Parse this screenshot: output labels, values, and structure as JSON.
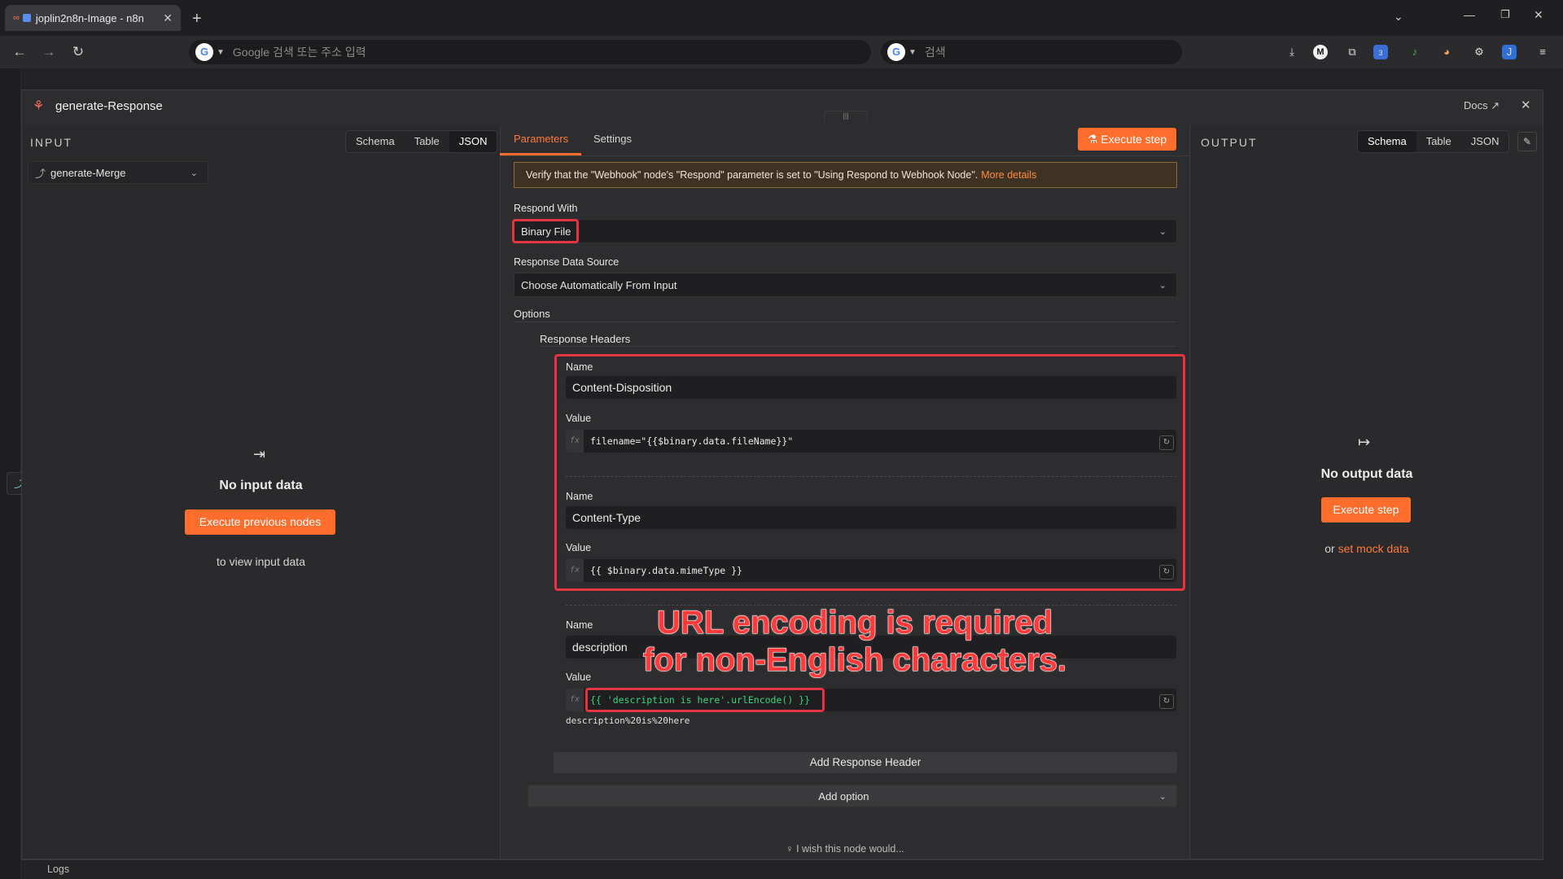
{
  "browser": {
    "tab_title": "joplin2n8n-Image - n8n",
    "address_placeholder": "Google 검색 또는 주소 입력",
    "search_placeholder": "검색",
    "ext_m": "M",
    "ext_badge": "3"
  },
  "node": {
    "title": "generate-Response",
    "docs_label": "Docs"
  },
  "input": {
    "label": "INPUT",
    "tabs": [
      "Schema",
      "Table",
      "JSON"
    ],
    "source": "generate-Merge",
    "empty_title": "No input data",
    "exec_prev_label": "Execute previous nodes",
    "empty_hint": "to view input data"
  },
  "params": {
    "tab_parameters": "Parameters",
    "tab_settings": "Settings",
    "execute_label": "Execute step",
    "notice": "Verify that the \"Webhook\" node's \"Respond\" parameter is set to \"Using Respond to Webhook Node\".",
    "notice_link": "More details",
    "respond_with_label": "Respond With",
    "respond_with_value": "Binary File",
    "data_source_label": "Response Data Source",
    "data_source_value": "Choose Automatically From Input",
    "options_label": "Options",
    "headers_label": "Response Headers",
    "name_label": "Name",
    "value_label": "Value",
    "headers": [
      {
        "name": "Content-Disposition",
        "value": "filename=\"{{$binary.data.fileName}}\""
      },
      {
        "name": "Content-Type",
        "value": "{{ $binary.data.mimeType }}"
      },
      {
        "name": "description",
        "value": "{{ 'description is here'.urlEncode() }}",
        "preview": "description%20is%20here"
      }
    ],
    "add_header_label": "Add Response Header",
    "add_option_label": "Add option",
    "wish_label": "I wish this node would..."
  },
  "annotation": {
    "line1": "URL encoding is required",
    "line2": "for non-English characters."
  },
  "output": {
    "label": "OUTPUT",
    "tabs": [
      "Schema",
      "Table",
      "JSON"
    ],
    "empty_title": "No output data",
    "execute_label": "Execute step",
    "or_text": "or",
    "mock_link": "set mock data"
  },
  "footer": {
    "logs_label": "Logs"
  },
  "colors": {
    "accent": "#ff6d2d",
    "annotation": "#e3343f"
  }
}
